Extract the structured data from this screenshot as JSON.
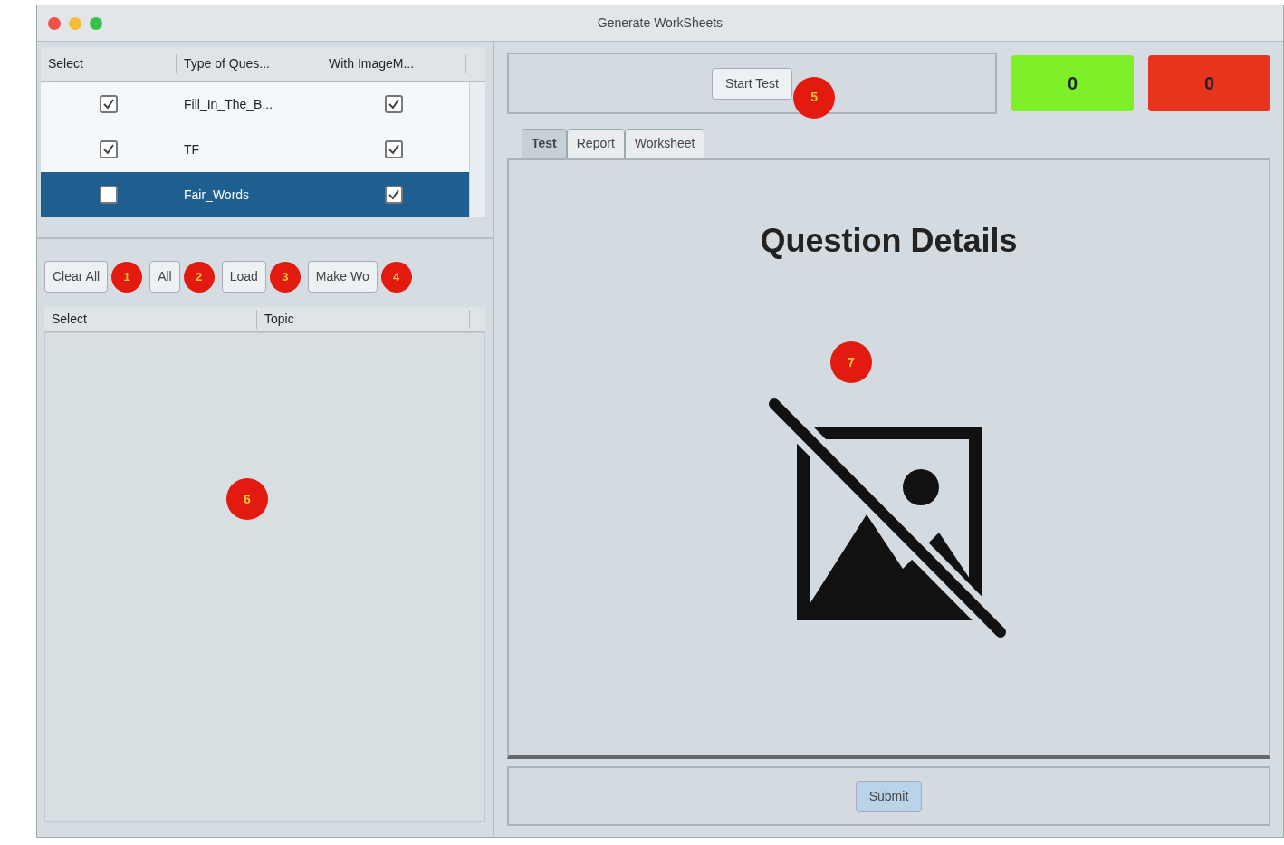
{
  "window": {
    "title": "Generate WorkSheets"
  },
  "question_types": {
    "columns": [
      "Select",
      "Type of Ques...",
      "With ImageM..."
    ],
    "rows": [
      {
        "select": true,
        "type": "Fill_In_The_B...",
        "with_image": true,
        "selected": false
      },
      {
        "select": true,
        "type": "TF",
        "with_image": true,
        "selected": false
      },
      {
        "select": false,
        "type": "Fair_Words",
        "with_image": true,
        "selected": true
      }
    ]
  },
  "topic_buttons": [
    {
      "label": "Clear All",
      "marker": "1"
    },
    {
      "label": "All",
      "marker": "2"
    },
    {
      "label": "Load",
      "marker": "3"
    },
    {
      "label": "Make Wo",
      "marker": "4"
    }
  ],
  "topics": {
    "columns": [
      "Select",
      "Topic"
    ],
    "marker": "6"
  },
  "start_button": {
    "label": "Start Test",
    "marker": "5"
  },
  "scores": [
    {
      "value": "0",
      "color": "#7ef027"
    },
    {
      "value": "0",
      "color": "#e8341c"
    }
  ],
  "tabs": [
    {
      "label": "Test",
      "selected": true
    },
    {
      "label": "Report",
      "selected": false
    },
    {
      "label": "Worksheet",
      "selected": false
    }
  ],
  "details": {
    "heading": "Question Details",
    "marker": "7"
  },
  "submit_button": {
    "label": "Submit"
  }
}
